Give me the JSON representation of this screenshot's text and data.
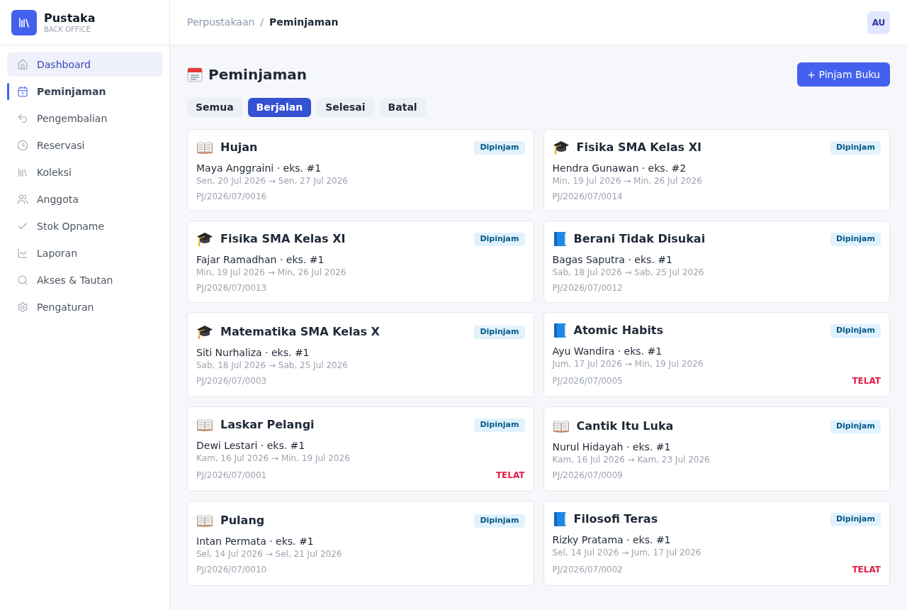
{
  "brand": {
    "name": "Pustaka",
    "subtitle": "BACK OFFICE"
  },
  "nav": {
    "items": [
      {
        "label": "Dashboard",
        "selected": false,
        "highlighted": true
      },
      {
        "label": "Peminjaman",
        "selected": true,
        "highlighted": false
      },
      {
        "label": "Pengembalian",
        "selected": false,
        "highlighted": false
      },
      {
        "label": "Reservasi",
        "selected": false,
        "highlighted": false
      },
      {
        "label": "Koleksi",
        "selected": false,
        "highlighted": false
      },
      {
        "label": "Anggota",
        "selected": false,
        "highlighted": false
      },
      {
        "label": "Stok Opname",
        "selected": false,
        "highlighted": false
      },
      {
        "label": "Laporan",
        "selected": false,
        "highlighted": false
      },
      {
        "label": "Akses & Tautan",
        "selected": false,
        "highlighted": false
      },
      {
        "label": "Pengaturan",
        "selected": false,
        "highlighted": false
      }
    ]
  },
  "breadcrumb": {
    "items": [
      "Perpustakaan",
      "Peminjaman"
    ],
    "separator": "/"
  },
  "user": {
    "initials": "AU"
  },
  "page": {
    "title": "Peminjaman",
    "action_button": "+ Pinjam Buku",
    "tabs": [
      {
        "label": "Semua",
        "selected": false
      },
      {
        "label": "Berjalan",
        "selected": true
      },
      {
        "label": "Selesai",
        "selected": false
      },
      {
        "label": "Batal",
        "selected": false
      }
    ],
    "loans": [
      {
        "kind": "open_book",
        "title": "Hujan",
        "status": "Dipinjam",
        "borrower": "Maya Anggraini · eks. #1",
        "period": "Sen, 20 Jul 2026 → Sen, 27 Jul 2026",
        "code": "PJ/2026/07/0016"
      },
      {
        "kind": "cap",
        "title": "Fisika SMA Kelas XI",
        "status": "Dipinjam",
        "borrower": "Hendra Gunawan · eks. #2",
        "period": "Min, 19 Jul 2026 → Min, 26 Jul 2026",
        "code": "PJ/2026/07/0014"
      },
      {
        "kind": "cap",
        "title": "Fisika SMA Kelas XI",
        "status": "Dipinjam",
        "borrower": "Fajar Ramadhan · eks. #1",
        "period": "Min, 19 Jul 2026 → Min, 26 Jul 2026",
        "code": "PJ/2026/07/0013"
      },
      {
        "kind": "book",
        "title": "Berani Tidak Disukai",
        "status": "Dipinjam",
        "borrower": "Bagas Saputra · eks. #1",
        "period": "Sab, 18 Jul 2026 → Sab, 25 Jul 2026",
        "code": "PJ/2026/07/0012"
      },
      {
        "kind": "cap",
        "title": "Matematika SMA Kelas X",
        "status": "Dipinjam",
        "borrower": "Siti Nurhaliza · eks. #1",
        "period": "Sab, 18 Jul 2026 → Sab, 25 Jul 2026",
        "code": "PJ/2026/07/0003"
      },
      {
        "kind": "book",
        "title": "Atomic Habits",
        "status": "Dipinjam",
        "borrower": "Ayu Wandira · eks. #1",
        "period": "Jum, 17 Jul 2026 → Min, 19 Jul 2026",
        "code": "PJ/2026/07/0005",
        "flag": "TELAT"
      },
      {
        "kind": "open_book",
        "title": "Laskar Pelangi",
        "status": "Dipinjam",
        "borrower": "Dewi Lestari · eks. #1",
        "period": "Kam, 16 Jul 2026 → Min, 19 Jul 2026",
        "code": "PJ/2026/07/0001",
        "flag": "TELAT"
      },
      {
        "kind": "open_book",
        "title": "Cantik Itu Luka",
        "status": "Dipinjam",
        "borrower": "Nurul Hidayah · eks. #1",
        "period": "Kam, 16 Jul 2026 → Kam, 23 Jul 2026",
        "code": "PJ/2026/07/0009"
      },
      {
        "kind": "open_book",
        "title": "Pulang",
        "status": "Dipinjam",
        "borrower": "Intan Permata · eks. #1",
        "period": "Sel, 14 Jul 2026 → Sel, 21 Jul 2026",
        "code": "PJ/2026/07/0010"
      },
      {
        "kind": "book",
        "title": "Filosofi Teras",
        "status": "Dipinjam",
        "borrower": "Rizky Pratama · eks. #1",
        "period": "Sel, 14 Jul 2026 → Jum, 17 Jul 2026",
        "code": "PJ/2026/07/0002",
        "flag": "TELAT"
      }
    ]
  }
}
